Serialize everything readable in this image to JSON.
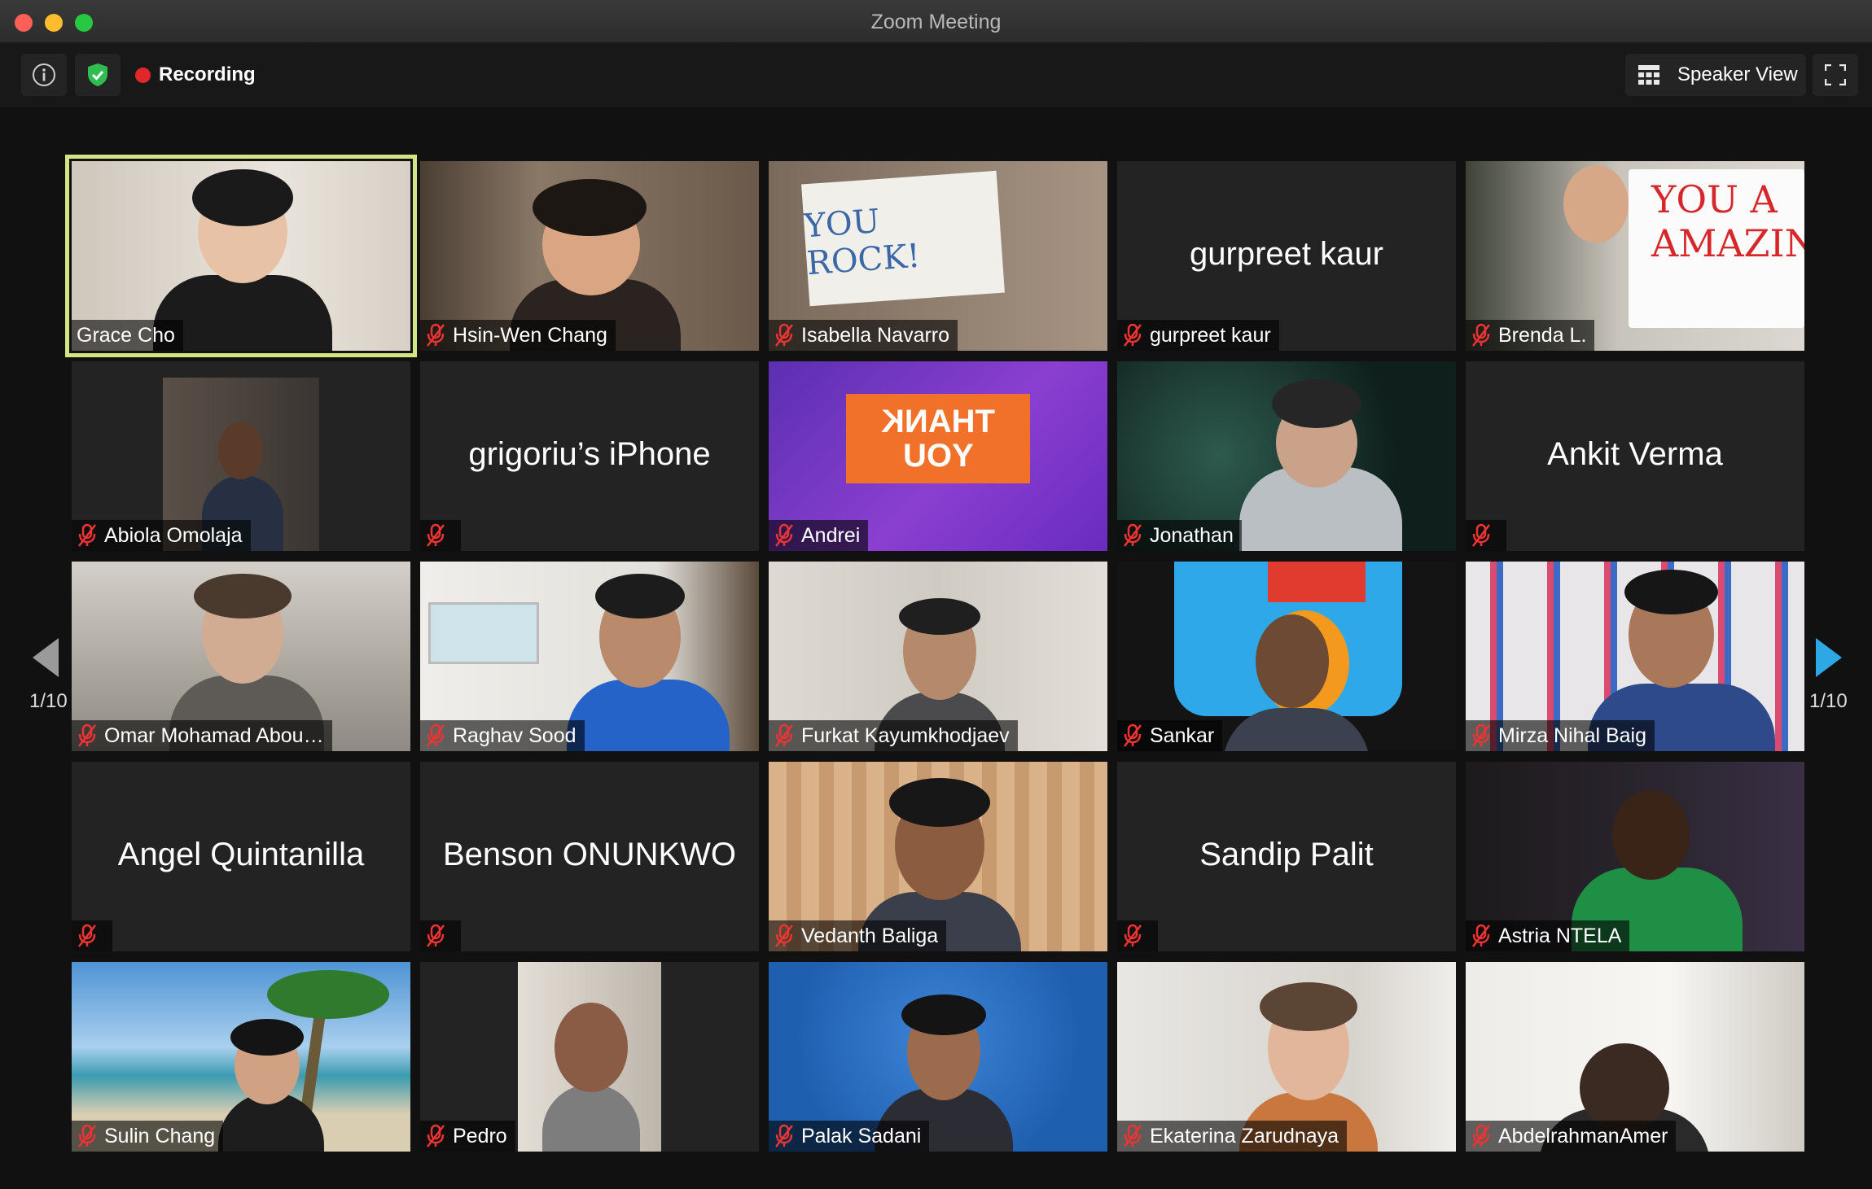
{
  "window": {
    "title": "Zoom Meeting"
  },
  "toolbar": {
    "recording_label": "Recording",
    "view_button_label": "Speaker View",
    "colors": {
      "recording": "#e02828",
      "shield": "#2fbd52",
      "active_speaker": "#d3e583"
    }
  },
  "pagination": {
    "left_label": "1/10",
    "right_label": "1/10",
    "arrow_color": "#2da8e5"
  },
  "participants": [
    {
      "label": "Grace Cho",
      "muted": false,
      "video": true,
      "active": true
    },
    {
      "label": "Hsin-Wen Chang",
      "muted": true,
      "video": true
    },
    {
      "label": "Isabella Navarro",
      "muted": true,
      "video": true
    },
    {
      "label": "gurpreet kaur",
      "muted": true,
      "video": false,
      "big_name": "gurpreet kaur"
    },
    {
      "label": "Brenda L.",
      "muted": true,
      "video": true
    },
    {
      "label": "Abiola Omolaja",
      "muted": true,
      "video": true
    },
    {
      "label": "",
      "muted": true,
      "video": false,
      "big_name": "grigoriu’s iPhone"
    },
    {
      "label": "Andrei",
      "muted": true,
      "video": true
    },
    {
      "label": "Jonathan",
      "muted": true,
      "video": true
    },
    {
      "label": "",
      "muted": true,
      "video": false,
      "big_name": "Ankit Verma"
    },
    {
      "label": "Omar Mohamad Abou…",
      "muted": true,
      "video": true
    },
    {
      "label": "Raghav Sood",
      "muted": true,
      "video": true
    },
    {
      "label": "Furkat Kayumkhodjaev",
      "muted": true,
      "video": true
    },
    {
      "label": "Sankar",
      "muted": true,
      "video": true
    },
    {
      "label": "Mirza Nihal Baig",
      "muted": true,
      "video": true
    },
    {
      "label": "",
      "muted": true,
      "video": false,
      "big_name": "Angel Quintanilla"
    },
    {
      "label": "",
      "muted": true,
      "video": false,
      "big_name": "Benson ONUNKWO"
    },
    {
      "label": "Vedanth Baliga",
      "muted": true,
      "video": true
    },
    {
      "label": "",
      "muted": true,
      "video": false,
      "big_name": "Sandip Palit"
    },
    {
      "label": "Astria NTELA",
      "muted": true,
      "video": true
    },
    {
      "label": "Sulin Chang",
      "muted": true,
      "video": true
    },
    {
      "label": "Pedro",
      "muted": true,
      "video": true
    },
    {
      "label": "Palak Sadani",
      "muted": true,
      "video": true
    },
    {
      "label": "Ekaterina Zarudnaya",
      "muted": true,
      "video": true
    },
    {
      "label": "AbdelrahmanAmer",
      "muted": true,
      "video": true
    }
  ],
  "signs": {
    "isabella": "YOU ROCK!",
    "brenda_line1": "YOU A",
    "brenda_line2": "AMAZIN",
    "andrei_line1": "THANK",
    "andrei_line2": "YOU"
  }
}
